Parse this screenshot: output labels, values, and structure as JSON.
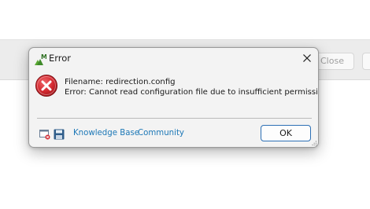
{
  "background": {
    "close_label": "Close"
  },
  "dialog": {
    "title": "Error",
    "app_icon": "app-logo-icon",
    "close_icon": "close-icon",
    "error_icon": "error-icon",
    "message_filename": "Filename: redirection.config",
    "message_error": "Error: Cannot read configuration file due to insufficient permissions",
    "footer": {
      "icons": [
        "details-window-icon",
        "save-icon"
      ],
      "knowledge_base_label": "Knowledge Base",
      "community_label": "Community",
      "ok_label": "OK"
    }
  },
  "colors": {
    "accent": "#2c6fb5",
    "link": "#1d78b7",
    "error": "#c4262e"
  }
}
